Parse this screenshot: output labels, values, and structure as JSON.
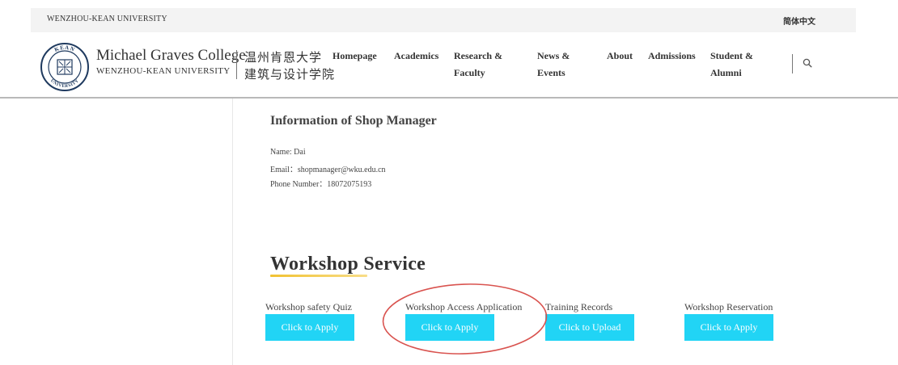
{
  "topbar": {
    "university": "WENZHOU-KEAN UNIVERSITY",
    "language": "简体中文"
  },
  "brand": {
    "college": "Michael Graves College",
    "university": "WENZHOU-KEAN UNIVERSITY",
    "cn_line1": "温州肯恩大学",
    "cn_line2": "建筑与设计学院",
    "seal_top": "KEAN",
    "seal_bottom": "UNIVERSITY"
  },
  "nav": {
    "homepage": "Homepage",
    "academics": "Academics",
    "research_1": "Research &",
    "research_2": "Faculty",
    "news_1": "News &",
    "news_2": "Events",
    "about": "About",
    "admissions": "Admissions",
    "student_1": "Student &",
    "student_2": "Alumni",
    "search_icon": "search-icon"
  },
  "shop_manager": {
    "title": "Information of Shop Manager",
    "name": "Name: Dai",
    "email": "Email：shopmanager@wku.edu.cn",
    "phone": "Phone Number：18072075193"
  },
  "workshop": {
    "title": "Workshop Service",
    "services": [
      {
        "label": "Workshop safety Quiz",
        "button": "Click to Apply"
      },
      {
        "label": "Workshop Access Application",
        "button": "Click to Apply"
      },
      {
        "label": "Training Records",
        "button": "Click to Upload"
      },
      {
        "label": "Workshop Reservation",
        "button": "Click to Apply"
      }
    ]
  },
  "colors": {
    "button": "#21d4f5",
    "underline_accent": "#f1c232",
    "annotation": "#d9534f",
    "topbar_bg": "#f3f3f3"
  }
}
